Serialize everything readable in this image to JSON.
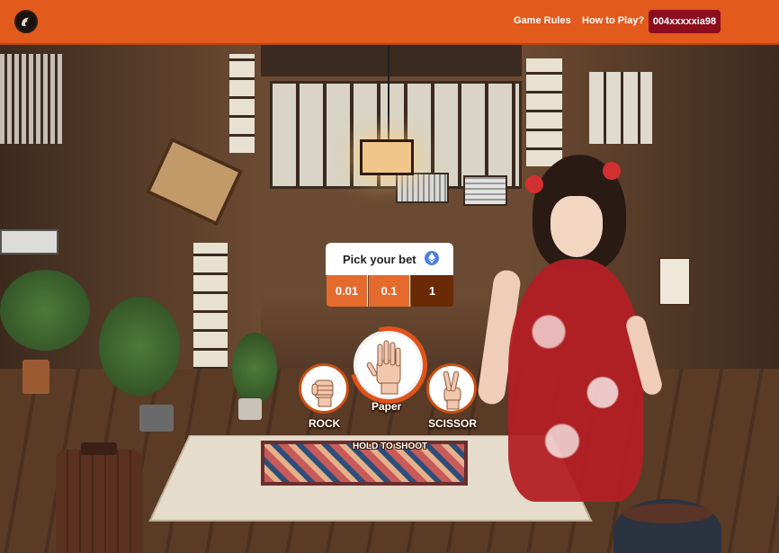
{
  "header": {
    "logo_icon": "dragon-logo-icon",
    "nav": [
      {
        "label": "Game Rules"
      },
      {
        "label": "How to Play?"
      }
    ],
    "wallet_label": "004xxxxxia98",
    "colors": {
      "header_bg": "#e25a1c",
      "wallet_bg": "#8c0d1e"
    }
  },
  "game": {
    "bet": {
      "title": "Pick your bet",
      "currency_icon": "ethereum-icon",
      "options": [
        "0.01",
        "0.1",
        "1"
      ],
      "selected": "1",
      "colors": {
        "option_bg": "#e56a2e",
        "selected_bg": "#6a2a06"
      }
    },
    "choices": [
      {
        "label": "ROCK",
        "icon": "rock-hand-icon"
      },
      {
        "label": "Paper",
        "icon": "paper-hand-icon"
      },
      {
        "label": "SCISSOR",
        "icon": "scissor-hand-icon"
      }
    ],
    "hold_prompt": "HOLD TO SHOOT"
  }
}
